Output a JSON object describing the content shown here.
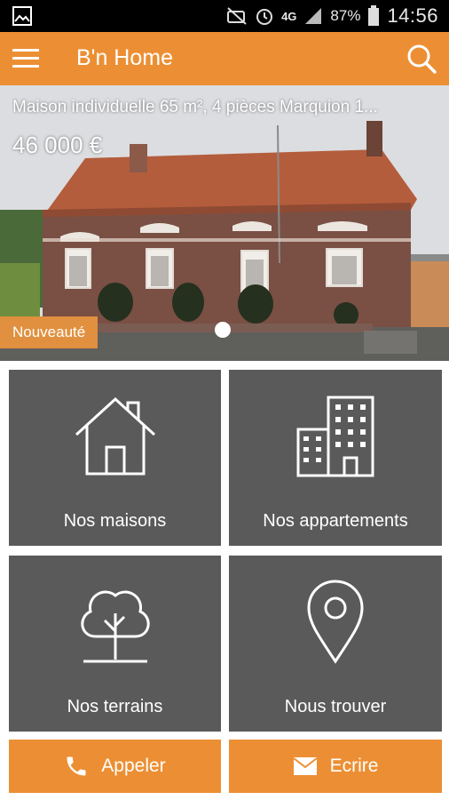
{
  "status_bar": {
    "battery": "87%",
    "network": "4G",
    "time": "14:56"
  },
  "header": {
    "title": "B'n Home",
    "menu_icon": "menu-icon",
    "search_icon": "search-icon"
  },
  "featured": {
    "title": "Maison individuelle 65 m², 4 pièces Marquion 1...",
    "price": "46 000 €",
    "badge": "Nouveauté",
    "slide_index": 1,
    "slide_count": 1
  },
  "tiles": [
    {
      "label": "Nos maisons",
      "icon": "house-icon"
    },
    {
      "label": "Nos appartements",
      "icon": "building-icon"
    },
    {
      "label": "Nos terrains",
      "icon": "tree-icon"
    },
    {
      "label": "Nous trouver",
      "icon": "location-pin-icon"
    }
  ],
  "actions": {
    "call_label": "Appeler",
    "write_label": "Ecrire"
  },
  "colors": {
    "accent": "#ec8f34",
    "tile_background": "#5a5a5a",
    "status_bar": "#000000"
  }
}
